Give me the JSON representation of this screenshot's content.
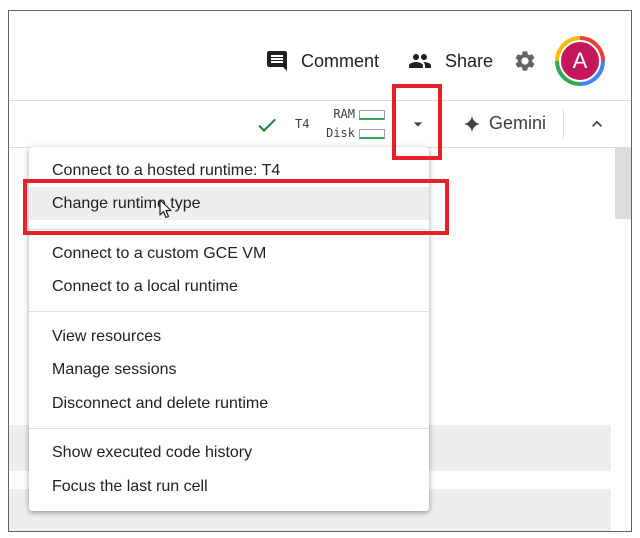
{
  "header": {
    "comment_label": "Comment",
    "share_label": "Share",
    "avatar_initial": "A"
  },
  "toolbar": {
    "gpu_label": "T4",
    "ram_label": "RAM",
    "disk_label": "Disk",
    "gemini_label": "Gemini"
  },
  "menu": {
    "group1": [
      "Connect to a hosted runtime: T4",
      "Change runtime type"
    ],
    "group2": [
      "Connect to a custom GCE VM",
      "Connect to a local runtime"
    ],
    "group3": [
      "View resources",
      "Manage sessions",
      "Disconnect and delete runtime"
    ],
    "group4": [
      "Show executed code history",
      "Focus the last run cell"
    ],
    "hovered_item": "Change runtime type"
  },
  "colors": {
    "highlight": "#e8202a",
    "connected_check": "#188038",
    "avatar_bg": "#c2185b"
  }
}
